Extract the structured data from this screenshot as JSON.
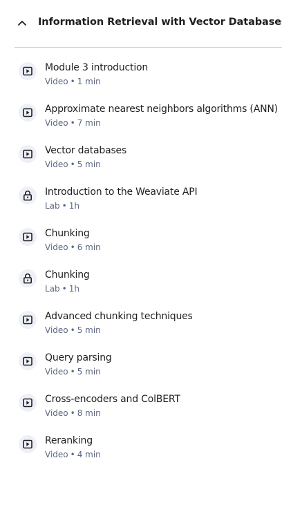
{
  "module": {
    "title": "Information Retrieval with Vector Databases",
    "expanded": true
  },
  "items": [
    {
      "title": "Module 3 introduction",
      "type": "Video",
      "duration": "1 min",
      "icon": "play-video-icon"
    },
    {
      "title": "Approximate nearest neighbors algorithms (ANN)",
      "type": "Video",
      "duration": "7 min",
      "icon": "play-video-icon"
    },
    {
      "title": "Vector databases",
      "type": "Video",
      "duration": "5 min",
      "icon": "play-video-icon"
    },
    {
      "title": "Introduction to the Weaviate API",
      "type": "Lab",
      "duration": "1h",
      "icon": "lock-icon"
    },
    {
      "title": "Chunking",
      "type": "Video",
      "duration": "6 min",
      "icon": "play-video-icon"
    },
    {
      "title": "Chunking",
      "type": "Lab",
      "duration": "1h",
      "icon": "lock-icon"
    },
    {
      "title": "Advanced chunking techniques",
      "type": "Video",
      "duration": "5 min",
      "icon": "play-video-icon"
    },
    {
      "title": "Query parsing",
      "type": "Video",
      "duration": "5 min",
      "icon": "play-video-icon"
    },
    {
      "title": "Cross-encoders and ColBERT",
      "type": "Video",
      "duration": "8 min",
      "icon": "play-video-icon"
    },
    {
      "title": "Reranking",
      "type": "Video",
      "duration": "4 min",
      "icon": "play-video-icon"
    }
  ],
  "separator": "•"
}
